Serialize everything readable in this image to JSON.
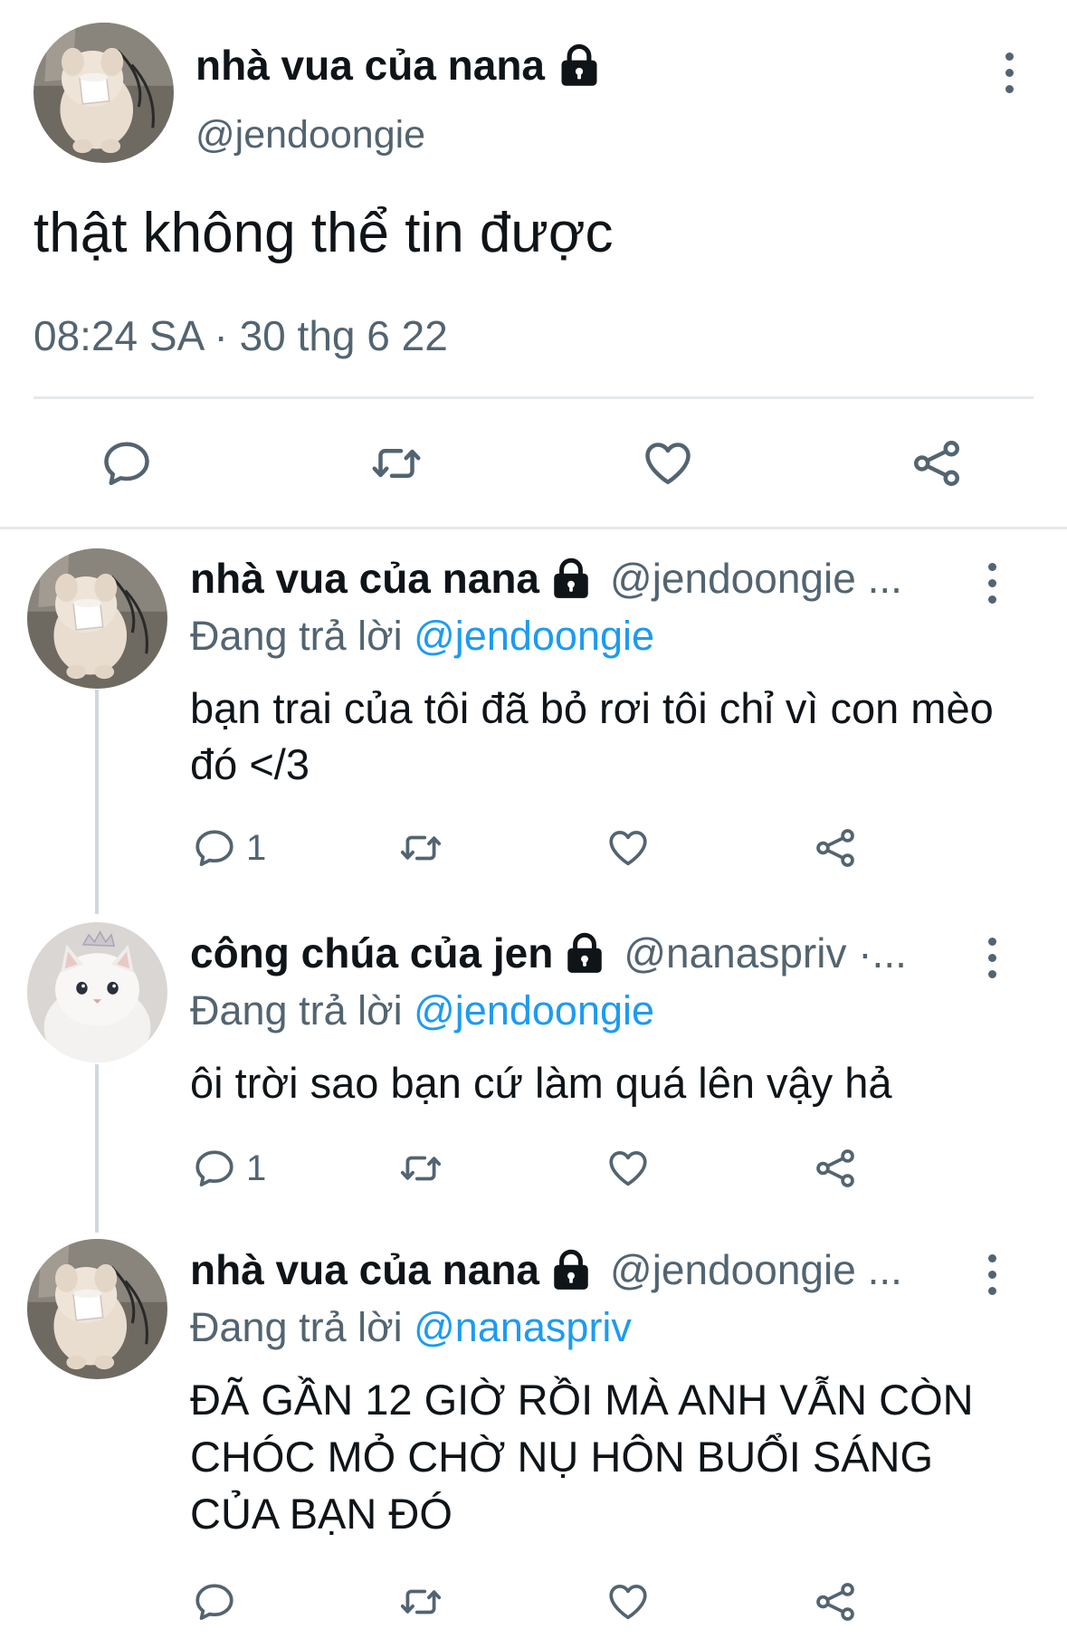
{
  "main_tweet": {
    "display_name": "nhà vua của nana",
    "handle": "@jendoongie",
    "text": "thật không thể tin được",
    "timestamp": "08:24 SA · 30 thg 6 22"
  },
  "replies": [
    {
      "display_name": "nhà vua của nana",
      "handle": "@jendoongie ...",
      "replying_prefix": "Đang trả lời",
      "replying_to": "@jendoongie",
      "text": "bạn trai của tôi đã bỏ rơi tôi chỉ vì con mèo đó </3",
      "reply_count": "1"
    },
    {
      "display_name": "công chúa của jen",
      "handle": "@nanaspriv ·...",
      "replying_prefix": "Đang trả lời",
      "replying_to": "@jendoongie",
      "text": "ôi trời sao bạn cứ làm quá lên vậy hả",
      "reply_count": "1"
    },
    {
      "display_name": "nhà vua của nana",
      "handle": "@jendoongie ...",
      "replying_prefix": "Đang trả lời",
      "replying_to": "@nanaspriv",
      "text": "ĐÃ GẦN 12 GIỜ RỒI MÀ ANH VẪN CÒN CHÓC MỎ CHỜ NỤ HÔN BUỔI SÁNG CỦA BẠN ĐÓ",
      "reply_count": ""
    }
  ],
  "icons": {
    "reply": "reply-icon",
    "retweet": "retweet-icon",
    "like": "heart-icon",
    "share": "share-icon",
    "lock": "lock-icon",
    "more": "more-vertical-icon"
  },
  "colors": {
    "text": "#0f1419",
    "secondary": "#536471",
    "link": "#1d9bf0",
    "divider": "#e6e9eb"
  }
}
